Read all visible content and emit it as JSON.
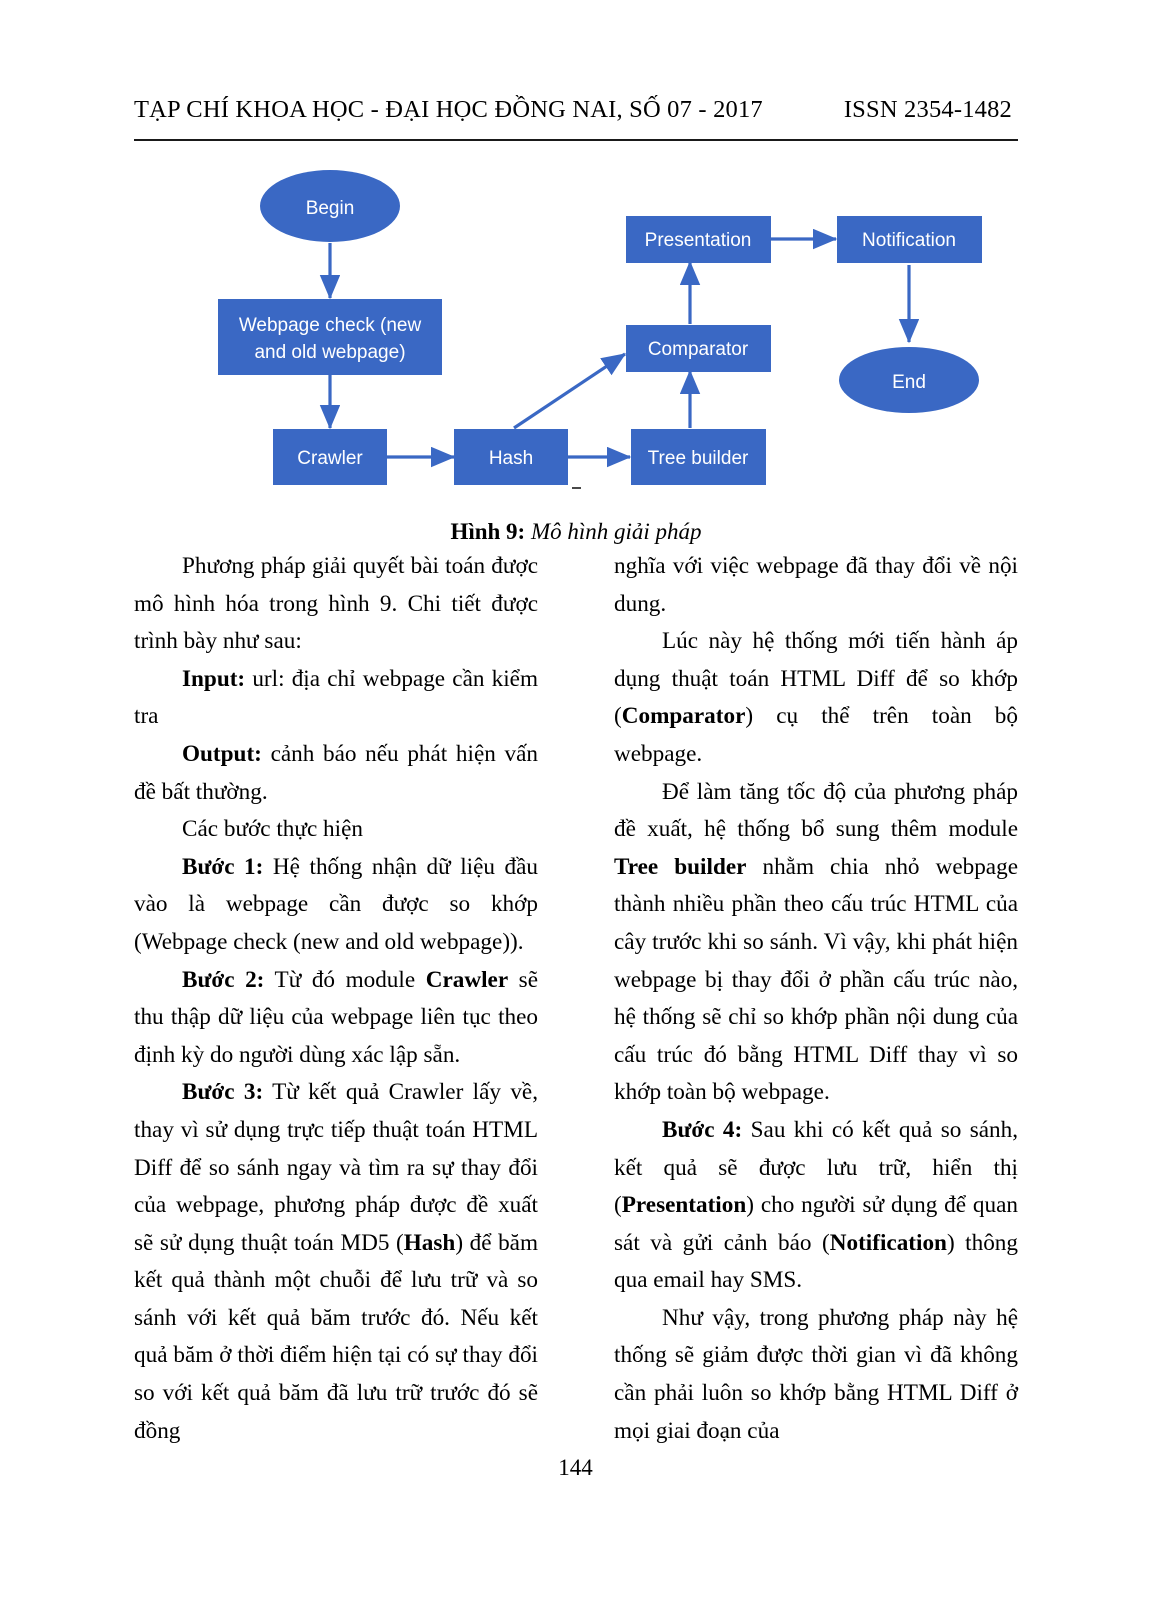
{
  "header": {
    "journal": "TẠP CHÍ KHOA HỌC - ĐẠI HỌC ĐỒNG NAI, SỐ 07 - 2017",
    "issn": "ISSN 2354-1482"
  },
  "figure": {
    "caption_number": "Hình 9:",
    "caption_text": "Mô hình giải pháp",
    "colors": {
      "node_fill": "#3a68c4",
      "node_text": "#ffffff",
      "arrow": "#3a68c4"
    },
    "nodes": {
      "begin": "Begin",
      "webpage_check": "Webpage check (new and old webpage)",
      "webpage_check_line1": "Webpage check (new",
      "webpage_check_line2": "and old webpage)",
      "crawler": "Crawler",
      "hash": "Hash",
      "tree_builder": "Tree builder",
      "comparator": "Comparator",
      "presentation": "Presentation",
      "notification": "Notification",
      "end": "End"
    },
    "edges": [
      "Begin -> Webpage check (new and old webpage)",
      "Webpage check (new and old webpage) -> Crawler",
      "Crawler -> Hash",
      "Hash -> Tree builder",
      "Hash -> Comparator",
      "Tree builder -> Comparator",
      "Comparator -> Presentation",
      "Presentation -> Notification",
      "Notification -> End"
    ]
  },
  "left_column": {
    "p1": "Phương pháp giải quyết bài toán được mô hình hóa trong hình 9. Chi tiết được trình bày như sau:",
    "p2_label": "Input:",
    "p2_rest": " url: địa chỉ webpage cần kiểm tra",
    "p3_label": "Output:",
    "p3_rest": " cảnh báo nếu phát hiện vấn đề bất thường.",
    "p4": "Các bước thực hiện",
    "p5_label": "Bước 1:",
    "p5_rest": " Hệ thống nhận dữ liệu đầu vào là webpage cần được so khớp (Webpage check (new and old webpage)).",
    "p6_label": "Bước 2:",
    "p6_a": " Từ đó module ",
    "p6_b": "Crawler",
    "p6_c": " sẽ thu thập dữ liệu của webpage liên tục theo định kỳ do người dùng xác lập sẵn.",
    "p7_label": "Bước 3:",
    "p7_a": " Từ kết quả Crawler lấy về, thay vì sử dụng trực tiếp thuật toán HTML Diff để so sánh ngay và tìm ra sự thay đổi của webpage, phương pháp được đề xuất sẽ sử dụng thuật toán MD5 (",
    "p7_b": "Hash",
    "p7_c": ") để băm kết quả thành một chuỗi để lưu trữ và so sánh với kết quả băm trước đó. Nếu kết quả băm ở thời điểm hiện tại có sự thay đổi so với kết quả băm đã lưu trữ trước đó sẽ đồng"
  },
  "right_column": {
    "p1": "nghĩa với việc webpage đã thay đổi về nội dung.",
    "p2_a": "Lúc này hệ thống mới tiến hành áp dụng thuật toán HTML Diff để so khớp (",
    "p2_b": "Comparator",
    "p2_c": ") cụ thể trên toàn bộ webpage.",
    "p3_a": "Để làm tăng tốc độ của phương pháp đề xuất, hệ thống bổ sung thêm module ",
    "p3_b": "Tree builder",
    "p3_c": " nhằm chia nhỏ webpage thành nhiều phần theo cấu trúc HTML của cây trước khi so sánh. Vì vậy, khi phát hiện webpage bị thay đổi ở phần cấu trúc nào, hệ thống sẽ chỉ so khớp phần nội dung của cấu trúc đó bằng HTML Diff thay vì so khớp toàn bộ webpage.",
    "p4_label": "Bước 4:",
    "p4_a": " Sau khi có kết quả so sánh, kết quả sẽ được lưu trữ, hiển thị (",
    "p4_b": "Presentation",
    "p4_c": ") cho người sử dụng để quan sát và gửi cảnh báo (",
    "p4_d": "Notification",
    "p4_e": ") thông qua email hay SMS.",
    "p5": "Như vậy, trong phương pháp này hệ thống sẽ giảm được thời gian vì đã không cần phải luôn so khớp bằng HTML Diff ở mọi giai đoạn của"
  },
  "footer": {
    "page_number": "144"
  }
}
